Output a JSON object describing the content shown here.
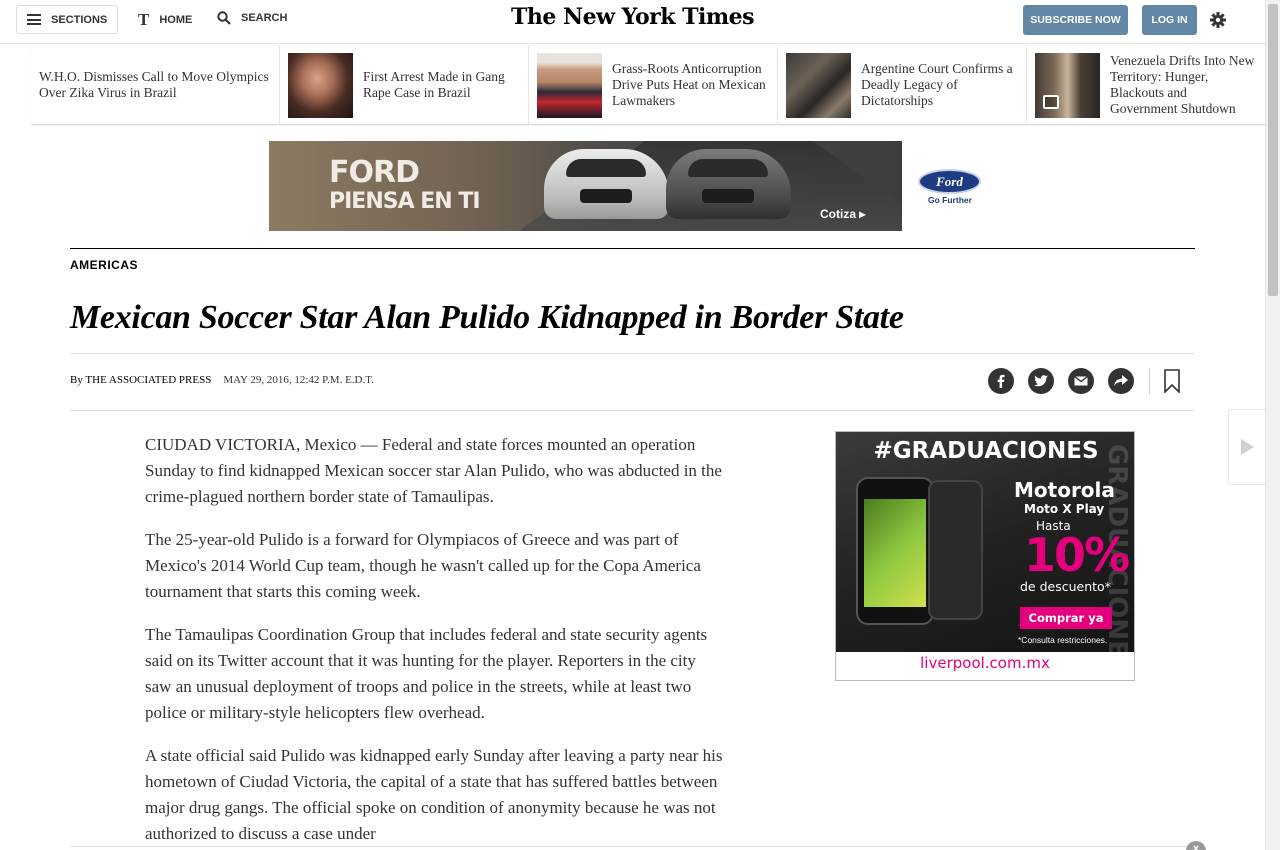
{
  "header": {
    "sections_label": "SECTIONS",
    "home_label": "HOME",
    "search_label": "SEARCH",
    "brand": "The New York Times",
    "subscribe_label": "SUBSCRIBE NOW",
    "login_label": "LOG IN",
    "home_logo": "T"
  },
  "ribbon": {
    "items": [
      {
        "text": "W.H.O. Dismisses Call to Move Olympics Over Zika Virus in Brazil",
        "has_image": false
      },
      {
        "text": "First Arrest Made in Gang Rape Case in Brazil",
        "has_image": true
      },
      {
        "text": "Grass-Roots Anticorruption Drive Puts Heat on Mexican Lawmakers",
        "has_image": true
      },
      {
        "text": "Argentine Court Confirms a Deadly Legacy of Dictatorships",
        "has_image": true
      },
      {
        "text": "Venezuela Drifts Into New Territory: Hunger, Blackouts and Government Shutdown",
        "has_image": true,
        "video": true
      }
    ]
  },
  "banner_ad": {
    "line1": "FORD",
    "line2": "PIENSA EN TI",
    "cta": "Cotiza ▸",
    "logo": "Ford",
    "tagline": "Go Further"
  },
  "article": {
    "section": "AMERICAS",
    "headline": "Mexican Soccer Star Alan Pulido Kidnapped in Border State",
    "byline_prefix": "By",
    "author": "THE ASSOCIATED PRESS",
    "date": "MAY 29, 2016, 12:42 P.M. E.D.T.",
    "paragraphs": [
      "CIUDAD VICTORIA, Mexico — Federal and state forces mounted an operation Sunday to find kidnapped Mexican soccer star Alan Pulido, who was abducted in the crime-plagued northern border state of Tamaulipas.",
      "The 25-year-old Pulido is a forward for Olympiacos of Greece and was part of Mexico's 2014 World Cup team, though he wasn't called up for the Copa America tournament that starts this coming week.",
      "The Tamaulipas Coordination Group that includes federal and state security agents said on its Twitter account that it was hunting for the player. Reporters in the city saw an unusual deployment of troops and police in the streets, while at least two police or military-style helicopters flew overhead.",
      "A state official said Pulido was kidnapped early Sunday after leaving a party near his hometown of Ciudad Victoria, the capital of a state that has suffered battles between major drug gangs. The official spoke on condition of anonymity because he was not authorized to discuss a case under"
    ]
  },
  "side_ad": {
    "headline": "#GRADUACIONES",
    "vertical": "GRADUACIONES",
    "brand": "Motorola",
    "model": "Moto X Play",
    "hasta": "Hasta",
    "percent": "10%",
    "discount": "de descuento*",
    "button": "Comprar ya",
    "conditions": "*Consulta restricciones.",
    "store": "liverpool.com.mx"
  },
  "colors": {
    "button_blue": "#6288a5",
    "ad_magenta": "#e4007c",
    "ford_blue": "#1f3b82"
  }
}
